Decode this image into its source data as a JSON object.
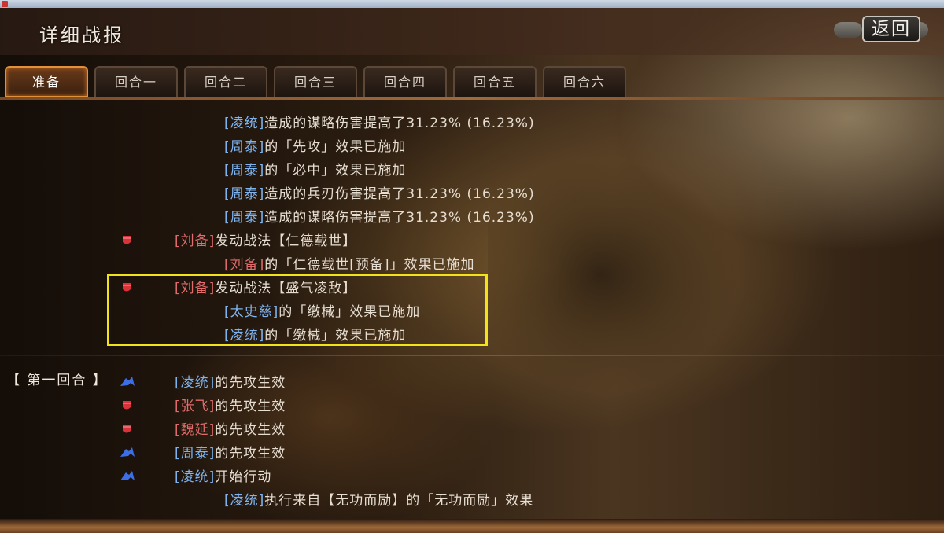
{
  "header": {
    "title": "详细战报",
    "back_label": "返回"
  },
  "tabs": [
    {
      "label": "准备",
      "active": true
    },
    {
      "label": "回合一",
      "active": false
    },
    {
      "label": "回合二",
      "active": false
    },
    {
      "label": "回合三",
      "active": false
    },
    {
      "label": "回合四",
      "active": false
    },
    {
      "label": "回合五",
      "active": false
    },
    {
      "label": "回合六",
      "active": false
    }
  ],
  "colors": {
    "blue_faction": "#7fb4f0",
    "red_faction": "#e06c6c",
    "highlight": "#f2e21a",
    "active_tab": "#e0913a"
  },
  "log": {
    "prep_lines": [
      {
        "name": "[凌统]",
        "side": "blue",
        "text": "造成的谋略伤害提高了31.23% (16.23%)"
      },
      {
        "name": "[周泰]",
        "side": "blue",
        "text": "的「先攻」效果已施加"
      },
      {
        "name": "[周泰]",
        "side": "blue",
        "text": "的「必中」效果已施加"
      },
      {
        "name": "[周泰]",
        "side": "blue",
        "text": "造成的兵刃伤害提高了31.23% (16.23%)"
      },
      {
        "name": "[周泰]",
        "side": "blue",
        "text": "造成的谋略伤害提高了31.23% (16.23%)"
      },
      {
        "name": "[刘备]",
        "side": "red",
        "text": "发动战法【仁德载世】",
        "icon": "red-shield-icon"
      },
      {
        "name": "[刘备]",
        "side": "red",
        "text": "的「仁德载世[预备]」效果已施加"
      },
      {
        "name": "[刘备]",
        "side": "red",
        "text": "发动战法【盛气凌敌】",
        "icon": "red-shield-icon"
      },
      {
        "name": "[太史慈]",
        "side": "blue",
        "text": "的「缴械」效果已施加"
      },
      {
        "name": "[凌统]",
        "side": "blue",
        "text": "的「缴械」效果已施加"
      }
    ],
    "round_label": "【 第一回合 】",
    "round1_lines": [
      {
        "name": "[凌统]",
        "side": "blue",
        "text": "的先攻生效",
        "icon": "blue-arrow-icon"
      },
      {
        "name": "[张飞]",
        "side": "red",
        "text": "的先攻生效",
        "icon": "red-shield-icon"
      },
      {
        "name": "[魏延]",
        "side": "red",
        "text": "的先攻生效",
        "icon": "red-shield-icon"
      },
      {
        "name": "[周泰]",
        "side": "blue",
        "text": "的先攻生效",
        "icon": "blue-arrow-icon"
      },
      {
        "name": "[凌统]",
        "side": "blue",
        "text": "开始行动",
        "icon": "blue-arrow-icon"
      },
      {
        "name": "[凌统]",
        "side": "blue",
        "text": "执行来自【无功而励】的「无功而励」效果"
      }
    ]
  }
}
